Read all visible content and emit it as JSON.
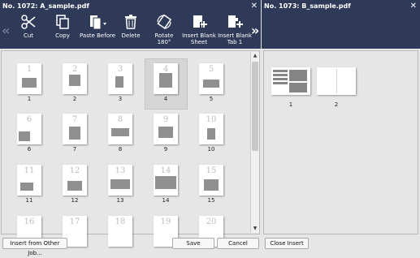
{
  "left_window": {
    "title": "No. 1072: A_sample.pdf"
  },
  "right_window": {
    "title": "No. 1073: B_sample.pdf"
  },
  "toolbar": {
    "cut": "Cut",
    "copy": "Copy",
    "paste_before": "Paste Before",
    "delete": "Delete",
    "rotate": "Rotate 180°",
    "insert_blank_sheet_1": "Insert Blank",
    "insert_blank_sheet_2": "Sheet",
    "insert_blank_tab_1": "Insert Blank",
    "insert_blank_tab_2": "Tab 1",
    "prev_arrow": "«",
    "next_arrow": "»"
  },
  "left_pages": [
    "1",
    "2",
    "3",
    "4",
    "5",
    "6",
    "7",
    "8",
    "9",
    "10",
    "11",
    "12",
    "13",
    "14",
    "15",
    "16",
    "17",
    "18",
    "19",
    "20"
  ],
  "right_pages": [
    "1",
    "2"
  ],
  "selected_page": "4",
  "buttons": {
    "insert_from_other_job": "Insert from Other Job...",
    "save": "Save",
    "cancel": "Cancel",
    "close_insert": "Close Insert"
  },
  "colors": {
    "titlebar": "#2f3a59",
    "background": "#e6e6e6"
  }
}
